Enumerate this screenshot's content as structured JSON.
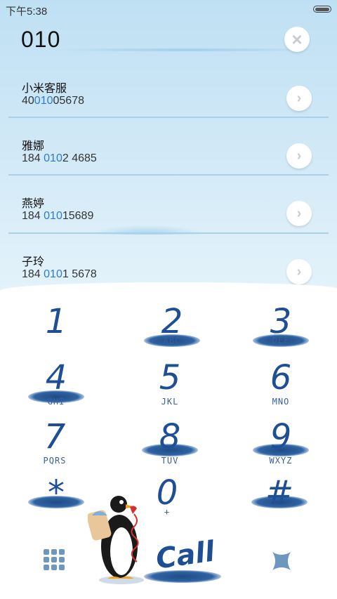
{
  "status_bar": {
    "time": "下午5:38"
  },
  "search": {
    "value": "010",
    "clear_icon": "close-icon"
  },
  "contacts": [
    {
      "name": "小米客服",
      "number_parts": [
        "40",
        "010",
        "05678"
      ]
    },
    {
      "name": "雅娜",
      "number_parts": [
        "184 ",
        "010",
        "2 4685"
      ]
    },
    {
      "name": "燕婷",
      "number_parts": [
        "184 ",
        "010",
        "15689"
      ]
    },
    {
      "name": "子玲",
      "number_parts": [
        "184 ",
        "010",
        "1 5678"
      ]
    }
  ],
  "dialpad": {
    "keys": [
      {
        "digit": "1",
        "letters": ""
      },
      {
        "digit": "2",
        "letters": "ABC"
      },
      {
        "digit": "3",
        "letters": "DEF"
      },
      {
        "digit": "4",
        "letters": "GHI"
      },
      {
        "digit": "5",
        "letters": "JKL"
      },
      {
        "digit": "6",
        "letters": "MNO"
      },
      {
        "digit": "7",
        "letters": "PQRS"
      },
      {
        "digit": "8",
        "letters": "TUV"
      },
      {
        "digit": "9",
        "letters": "WXYZ"
      },
      {
        "digit": "*",
        "letters": ""
      },
      {
        "digit": "0",
        "letters": "+"
      },
      {
        "digit": "#",
        "letters": ""
      }
    ],
    "call_label": "Call"
  },
  "colors": {
    "accent": "#2f7ad0",
    "digit": "#1e4f95",
    "sky_top": "#bfe0f4"
  }
}
